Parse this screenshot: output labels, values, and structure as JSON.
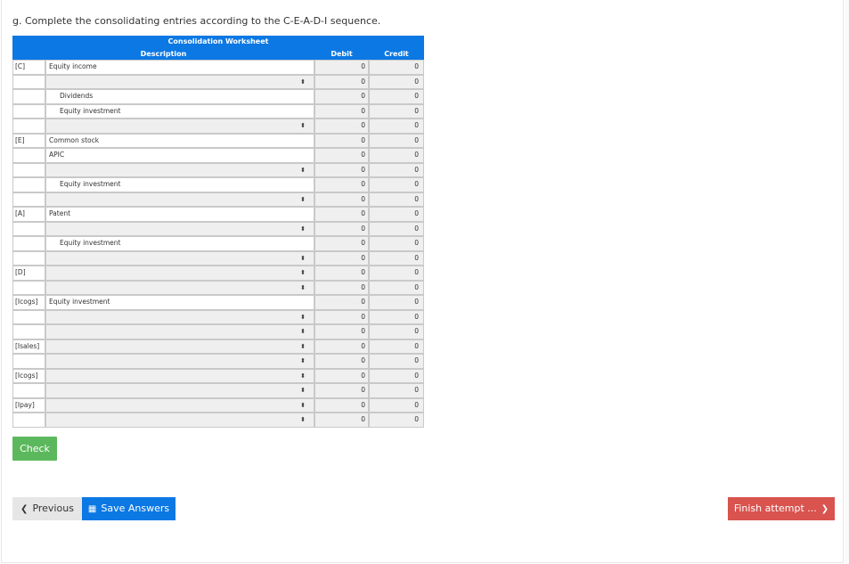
{
  "question": "g. Complete the consolidating entries according to the C-E-A-D-I sequence.",
  "worksheet": {
    "title": "Consolidation Worksheet",
    "col_description": "Description",
    "col_debit": "Debit",
    "col_credit": "Credit",
    "rows": [
      {
        "code": "[C]",
        "desc": "Equity income",
        "indent": false,
        "select": false,
        "debit": "0",
        "credit": "0"
      },
      {
        "code": "",
        "desc": "",
        "indent": false,
        "select": true,
        "debit": "0",
        "credit": "0"
      },
      {
        "code": "",
        "desc": "Dividends",
        "indent": true,
        "select": false,
        "debit": "0",
        "credit": "0"
      },
      {
        "code": "",
        "desc": "Equity investment",
        "indent": true,
        "select": false,
        "debit": "0",
        "credit": "0"
      },
      {
        "code": "",
        "desc": "",
        "indent": false,
        "select": true,
        "debit": "0",
        "credit": "0"
      },
      {
        "code": "[E]",
        "desc": "Common stock",
        "indent": false,
        "select": false,
        "debit": "0",
        "credit": "0"
      },
      {
        "code": "",
        "desc": "APIC",
        "indent": false,
        "select": false,
        "debit": "0",
        "credit": "0"
      },
      {
        "code": "",
        "desc": "",
        "indent": false,
        "select": true,
        "debit": "0",
        "credit": "0"
      },
      {
        "code": "",
        "desc": "Equity investment",
        "indent": true,
        "select": false,
        "debit": "0",
        "credit": "0"
      },
      {
        "code": "",
        "desc": "",
        "indent": false,
        "select": true,
        "debit": "0",
        "credit": "0"
      },
      {
        "code": "[A]",
        "desc": "Patent",
        "indent": false,
        "select": false,
        "debit": "0",
        "credit": "0"
      },
      {
        "code": "",
        "desc": "",
        "indent": false,
        "select": true,
        "debit": "0",
        "credit": "0"
      },
      {
        "code": "",
        "desc": "Equity investment",
        "indent": true,
        "select": false,
        "debit": "0",
        "credit": "0"
      },
      {
        "code": "",
        "desc": "",
        "indent": false,
        "select": true,
        "debit": "0",
        "credit": "0"
      },
      {
        "code": "[D]",
        "desc": "",
        "indent": false,
        "select": true,
        "debit": "0",
        "credit": "0"
      },
      {
        "code": "",
        "desc": "",
        "indent": false,
        "select": true,
        "debit": "0",
        "credit": "0"
      },
      {
        "code": "[Icogs]",
        "desc": "Equity investment",
        "indent": false,
        "select": false,
        "debit": "0",
        "credit": "0"
      },
      {
        "code": "",
        "desc": "",
        "indent": false,
        "select": true,
        "debit": "0",
        "credit": "0"
      },
      {
        "code": "",
        "desc": "",
        "indent": false,
        "select": true,
        "debit": "0",
        "credit": "0"
      },
      {
        "code": "[Isales]",
        "desc": "",
        "indent": false,
        "select": true,
        "debit": "0",
        "credit": "0"
      },
      {
        "code": "",
        "desc": "",
        "indent": false,
        "select": true,
        "debit": "0",
        "credit": "0"
      },
      {
        "code": "[Icogs]",
        "desc": "",
        "indent": false,
        "select": true,
        "debit": "0",
        "credit": "0"
      },
      {
        "code": "",
        "desc": "",
        "indent": false,
        "select": true,
        "debit": "0",
        "credit": "0"
      },
      {
        "code": "[Ipay]",
        "desc": "",
        "indent": false,
        "select": true,
        "debit": "0",
        "credit": "0"
      },
      {
        "code": "",
        "desc": "",
        "indent": false,
        "select": true,
        "debit": "0",
        "credit": "0"
      }
    ]
  },
  "buttons": {
    "check": "Check",
    "previous": "Previous",
    "save": "Save Answers",
    "finish": "Finish attempt ..."
  },
  "icons": {
    "select_arrow": "sort-arrows-icon",
    "previous": "chevron-left-circle-icon",
    "save": "floppy-disk-icon",
    "finish": "chevron-right-circle-icon"
  },
  "colors": {
    "header_blue": "#0b78e3",
    "check_green": "#5cb85c",
    "finish_red": "#d9534f"
  }
}
